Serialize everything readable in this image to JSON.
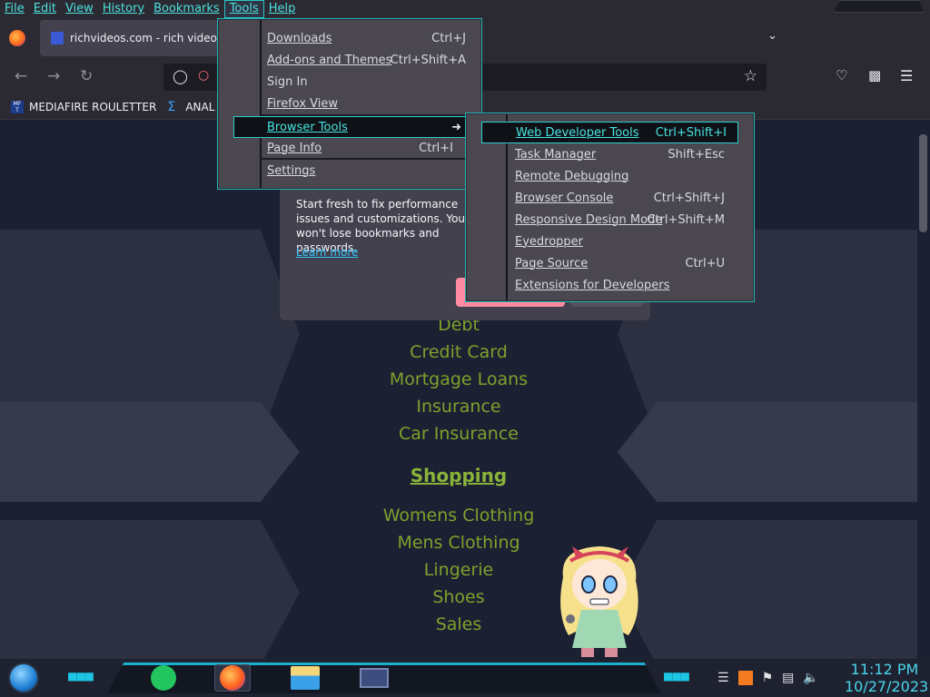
{
  "menubar": {
    "items": [
      "File",
      "Edit",
      "View",
      "History",
      "Bookmarks",
      "Tools",
      "Help"
    ],
    "active": "Tools"
  },
  "tab": {
    "title": "richvideos.com - rich videos",
    "title_overflow": "R"
  },
  "bookmarks": {
    "items": [
      "MEDIAFIRE ROULETTER",
      "ANAL PRO"
    ],
    "mf_icon_text": "MF T"
  },
  "tools_menu": {
    "items": [
      {
        "label": "Downloads",
        "shortcut": "Ctrl+J"
      },
      {
        "label": "Add-ons and Themes",
        "shortcut": "Ctrl+Shift+A"
      },
      {
        "label": "Sign In",
        "shortcut": ""
      },
      {
        "label": "Firefox View",
        "shortcut": ""
      },
      {
        "label": "Browser Tools",
        "shortcut": "",
        "submenu": true
      },
      {
        "label": "Page Info",
        "shortcut": "Ctrl+I"
      },
      {
        "label": "Settings",
        "shortcut": ""
      }
    ]
  },
  "browser_tools_menu": {
    "items": [
      {
        "label": "Web Developer Tools",
        "shortcut": "Ctrl+Shift+I"
      },
      {
        "label": "Task Manager",
        "shortcut": "Shift+Esc"
      },
      {
        "label": "Remote Debugging",
        "shortcut": ""
      },
      {
        "label": "Browser Console",
        "shortcut": "Ctrl+Shift+J"
      },
      {
        "label": "Responsive Design Mode",
        "shortcut": "Ctrl+Shift+M"
      },
      {
        "label": "Eyedropper",
        "shortcut": ""
      },
      {
        "label": "Page Source",
        "shortcut": "Ctrl+U"
      },
      {
        "label": "Extensions for Developers",
        "shortcut": ""
      }
    ]
  },
  "panel": {
    "text": "Start fresh to fix performance issues and customizations. You won't lose bookmarks and passwords.",
    "learn_more": "Learn more"
  },
  "page": {
    "finance_links": [
      "Debt",
      "Credit Card",
      "Mortgage Loans",
      "Insurance",
      "Car Insurance"
    ],
    "shopping_heading": "Shopping",
    "shopping_links": [
      "Womens Clothing",
      "Mens Clothing",
      "Lingerie",
      "Shoes",
      "Sales"
    ]
  },
  "taskbar": {
    "time": "11:12 PM",
    "date": "10/27/2023"
  },
  "colors": {
    "accent": "#29c6c4",
    "link": "#7fa12c",
    "menu_bg": "#4a474f"
  }
}
